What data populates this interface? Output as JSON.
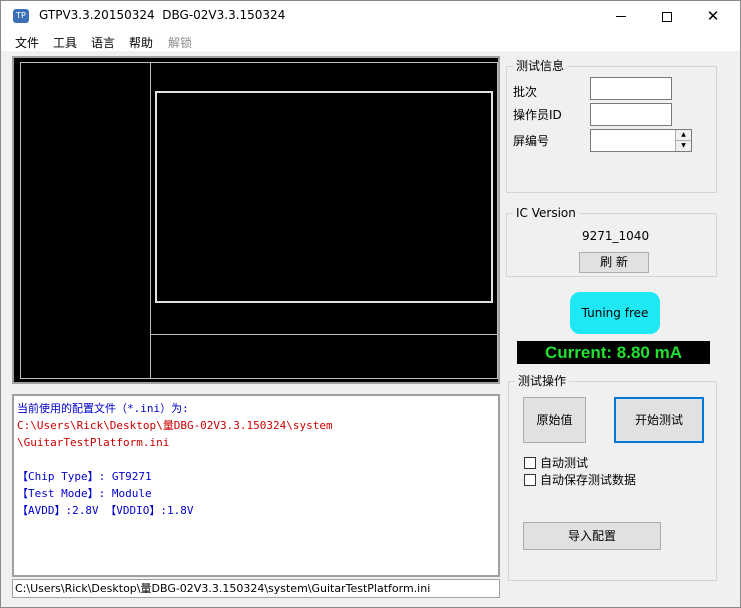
{
  "window": {
    "title": "GTPV3.3.20150324  DBG-02V3.3.150324",
    "icon_text": "TP",
    "controls": [
      "minimize",
      "maximize",
      "close"
    ]
  },
  "menu": [
    {
      "label": "文件",
      "enabled": true
    },
    {
      "label": "工具",
      "enabled": true
    },
    {
      "label": "语言",
      "enabled": true
    },
    {
      "label": "帮助",
      "enabled": true
    },
    {
      "label": "解锁",
      "enabled": false
    }
  ],
  "test_info": {
    "title": "测试信息",
    "batch_label": "批次",
    "batch_value": "",
    "operator_label": "操作员ID",
    "operator_value": "",
    "screen_label": "屏编号",
    "screen_value": ""
  },
  "ic_version": {
    "title": "IC Version",
    "value": "9271_1040",
    "refresh_label": "刷 新"
  },
  "tuning": {
    "label": "Tuning free",
    "color": "#1de8f4"
  },
  "current": {
    "text": "Current: 8.80 mA",
    "color": "#22e030"
  },
  "test_ops": {
    "title": "测试操作",
    "raw_button": "原始值",
    "start_button": "开始测试",
    "auto_test_label": "自动测试",
    "auto_test_checked": false,
    "auto_save_label": "自动保存测试数据",
    "auto_save_checked": false,
    "import_button": "导入配置"
  },
  "log": {
    "lines": [
      {
        "text": "当前使用的配置文件（*.ini）为:",
        "color": "blue"
      },
      {
        "text": "C:\\Users\\Rick\\Desktop\\量DBG-02V3.3.150324\\system",
        "color": "red"
      },
      {
        "text": "\\GuitarTestPlatform.ini",
        "color": "red"
      },
      {
        "text": "",
        "color": "blue"
      },
      {
        "text": "【Chip Type】: GT9271",
        "color": "blue"
      },
      {
        "text": "【Test Mode】: Module",
        "color": "blue"
      },
      {
        "text": "【AVDD】:2.8V 【VDDIO】:1.8V",
        "color": "blue"
      }
    ]
  },
  "status_path": "C:\\Users\\Rick\\Desktop\\量DBG-02V3.3.150324\\system\\GuitarTestPlatform.ini"
}
